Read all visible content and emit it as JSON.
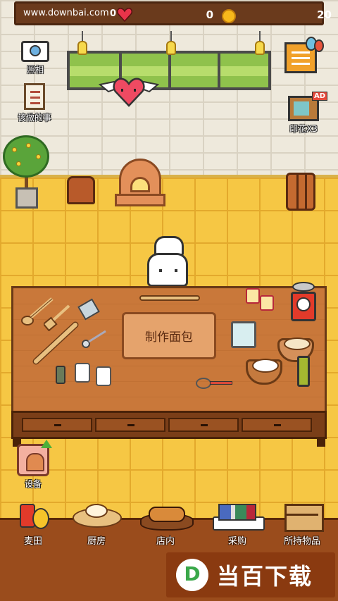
{
  "hud": {
    "watermark": "www.downbai.com",
    "left_value": "0",
    "hearts": "0",
    "coins": "20"
  },
  "side_buttons": {
    "photo": "照相",
    "todo": "该做的事",
    "stamps": "印花X3",
    "ad_tag": "AD"
  },
  "table": {
    "make_bread": "制作面包"
  },
  "equipment": {
    "label": "设备"
  },
  "nav": [
    {
      "label": "麦田",
      "icon": "wheat-field-icon"
    },
    {
      "label": "厨房",
      "icon": "kitchen-dough-icon"
    },
    {
      "label": "店内",
      "icon": "bread-tray-icon"
    },
    {
      "label": "采购",
      "icon": "shopping-icon"
    },
    {
      "label": "所持物品",
      "icon": "inventory-crate-icon"
    }
  ],
  "brand": {
    "logo_letter": "D",
    "text": "当百下载"
  },
  "colors": {
    "hud_bg": "#6a3a1c",
    "floor": "#f6c744",
    "table": "#c9783a",
    "nav_bg": "#9a4c1c",
    "brand_green": "#3aa84a"
  }
}
